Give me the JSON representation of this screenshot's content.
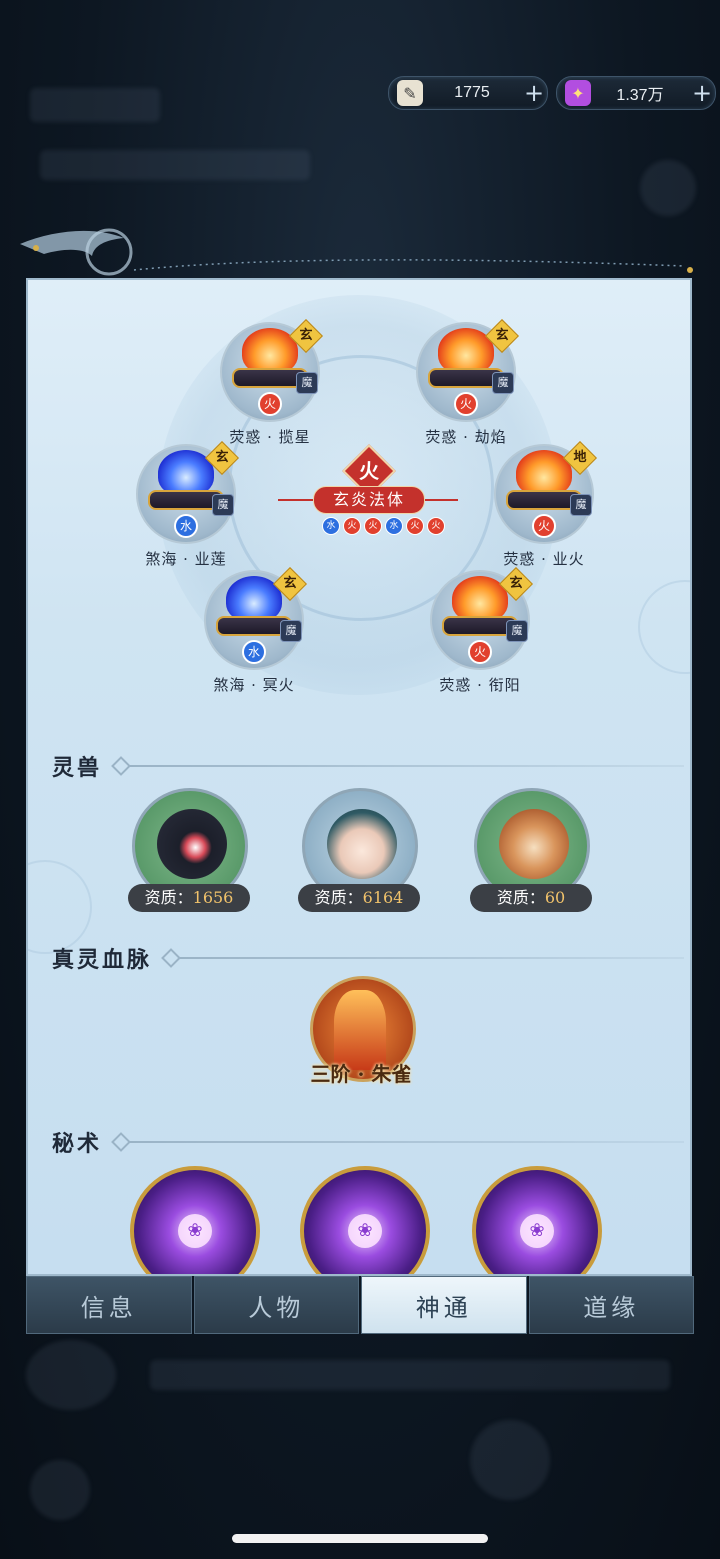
{
  "currency": [
    {
      "icon": "scroll-currency-icon",
      "value": "1775",
      "plus": "+"
    },
    {
      "icon": "spirit-stone-currency-icon",
      "value": "1.37万",
      "plus": "+"
    }
  ],
  "constellation": {
    "element": "火",
    "core_title": "玄炎法体",
    "core_elements": [
      "水",
      "火",
      "火",
      "水",
      "火",
      "火"
    ],
    "skills": [
      {
        "name": "荧惑 · 揽星",
        "tier": "玄",
        "school": "魔",
        "element": "火",
        "kind": "fire"
      },
      {
        "name": "荧惑 · 劫焰",
        "tier": "玄",
        "school": "魔",
        "element": "火",
        "kind": "fire"
      },
      {
        "name": "煞海 · 业莲",
        "tier": "玄",
        "school": "魔",
        "element": "水",
        "kind": "blue"
      },
      {
        "name": "荧惑 · 业火",
        "tier": "地",
        "school": "魔",
        "element": "火",
        "kind": "fire"
      },
      {
        "name": "煞海 · 冥火",
        "tier": "玄",
        "school": "魔",
        "element": "水",
        "kind": "blue"
      },
      {
        "name": "荧惑 · 衔阳",
        "tier": "玄",
        "school": "魔",
        "element": "火",
        "kind": "fire"
      }
    ]
  },
  "beasts": {
    "title": "灵兽",
    "label": "资质：",
    "items": [
      {
        "name": "black-bird-beast",
        "value": "1656"
      },
      {
        "name": "fox-spirit-beast",
        "value": "6164"
      },
      {
        "name": "deer-beast",
        "value": "60"
      }
    ]
  },
  "bloodline": {
    "title": "真灵血脉",
    "label": "三阶 · 朱雀"
  },
  "secrets": {
    "title": "秘术",
    "items": [
      "❀",
      "❀",
      "❀"
    ]
  },
  "tabs": [
    "信息",
    "人物",
    "神通",
    "道缘"
  ],
  "active_tab": "神通"
}
